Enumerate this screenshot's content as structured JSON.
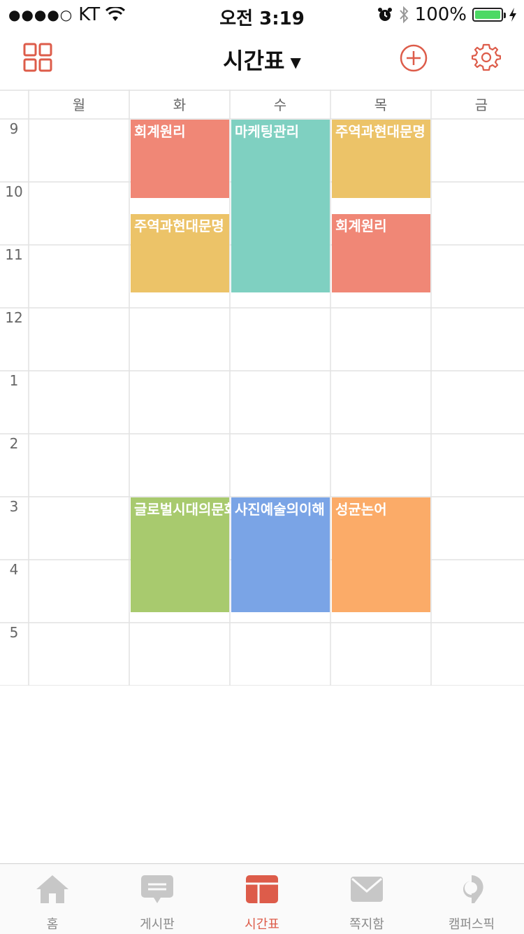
{
  "status_bar": {
    "signal": "●●●●○",
    "carrier": "KT",
    "time": "오전 3:19",
    "battery_percent": "100%",
    "battery_level": 1.0
  },
  "navbar": {
    "title": "시간표",
    "caret": "▼"
  },
  "colors": {
    "accent": "#dd5c4a",
    "grid_line": "#e2e2e2",
    "red": "#f08776",
    "yellow": "#ecc368",
    "teal": "#7fd0c1",
    "green": "#a8ca6e",
    "blue": "#7aa4e6",
    "orange": "#fbab68"
  },
  "timetable": {
    "days": [
      "월",
      "화",
      "수",
      "목",
      "금"
    ],
    "hours": [
      "9",
      "10",
      "11",
      "12",
      "1",
      "2",
      "3",
      "4",
      "5"
    ],
    "courses": [
      {
        "name": "회계원리",
        "day": 1,
        "start": 9.0,
        "end": 10.25,
        "color": "red"
      },
      {
        "name": "주역과현대문명",
        "day": 1,
        "start": 10.5,
        "end": 11.75,
        "color": "yellow"
      },
      {
        "name": "마케팅관리",
        "day": 2,
        "start": 9.0,
        "end": 11.75,
        "color": "teal"
      },
      {
        "name": "주역과현대문명",
        "day": 3,
        "start": 9.0,
        "end": 10.25,
        "color": "yellow"
      },
      {
        "name": "회계원리",
        "day": 3,
        "start": 10.5,
        "end": 11.75,
        "color": "red"
      },
      {
        "name": "글로벌시대의문화이해",
        "day": 1,
        "start": 15.0,
        "end": 16.83,
        "color": "green"
      },
      {
        "name": "사진예술의이해",
        "day": 2,
        "start": 15.0,
        "end": 16.83,
        "color": "blue"
      },
      {
        "name": "성균논어",
        "day": 3,
        "start": 15.0,
        "end": 16.83,
        "color": "orange"
      }
    ]
  },
  "tabbar": {
    "tabs": [
      {
        "label": "홈",
        "icon": "home-icon",
        "active": false
      },
      {
        "label": "게시판",
        "icon": "chat-bubble-icon",
        "active": false
      },
      {
        "label": "시간표",
        "icon": "timetable-icon",
        "active": true
      },
      {
        "label": "쪽지함",
        "icon": "mail-icon",
        "active": false
      },
      {
        "label": "캠퍼스픽",
        "icon": "campuspick-icon",
        "active": false
      }
    ]
  }
}
